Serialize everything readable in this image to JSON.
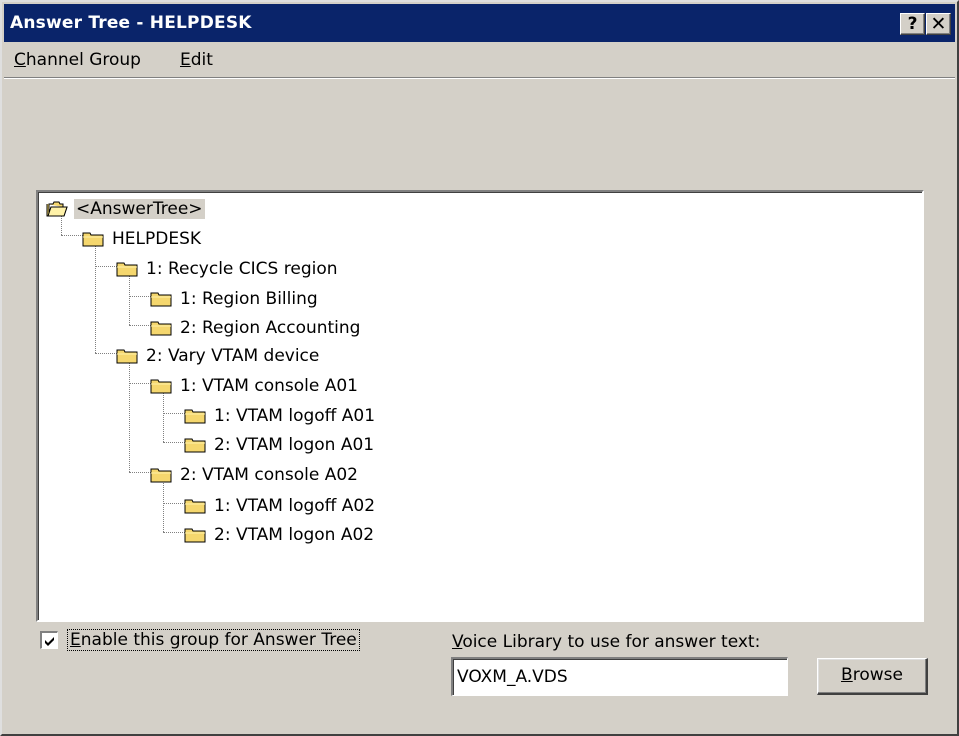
{
  "window": {
    "title": "Answer Tree - HELPDESK",
    "help_button": "?",
    "close_button": "✕"
  },
  "menu": {
    "items": [
      "Channel Group",
      "Edit"
    ]
  },
  "tree": {
    "nodes": [
      {
        "label": "<AnswerTree>",
        "level": 0,
        "selected": true
      },
      {
        "label": "HELPDESK",
        "level": 1
      },
      {
        "label": "1: Recycle CICS region",
        "level": 2
      },
      {
        "label": "1: Region Billing",
        "level": 3
      },
      {
        "label": "2: Region Accounting",
        "level": 3
      },
      {
        "label": "2: Vary VTAM device",
        "level": 2
      },
      {
        "label": "1: VTAM console A01",
        "level": 3
      },
      {
        "label": "1: VTAM logoff A01",
        "level": 4
      },
      {
        "label": "2: VTAM logon A01",
        "level": 4
      },
      {
        "label": "2: VTAM console A02",
        "level": 3
      },
      {
        "label": "1: VTAM logoff A02",
        "level": 4
      },
      {
        "label": "2: VTAM logon A02",
        "level": 4
      }
    ]
  },
  "options": {
    "enable_label": "Enable this group for Answer Tree",
    "enable_checked": true,
    "voice_library_label": "Voice Library to use for answer text:",
    "voice_library_value": "VOXM_A.VDS",
    "browse_label": "Browse"
  },
  "colors": {
    "titlebar": "#0a246a",
    "face": "#d4d0c8",
    "folder": "#f5d76e"
  }
}
